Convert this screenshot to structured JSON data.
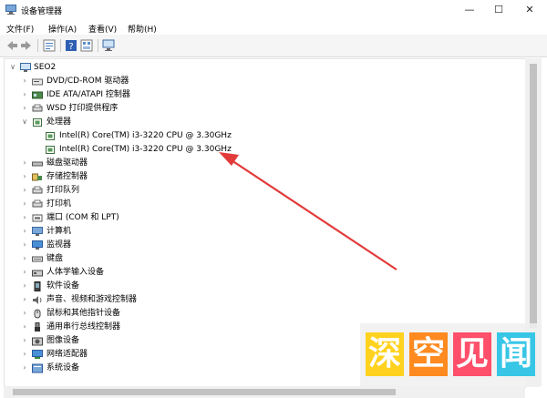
{
  "window": {
    "title": "设备管理器",
    "minimize": "—",
    "maximize": "☐",
    "close": "✕"
  },
  "menu": [
    "文件(F)",
    "操作(A)",
    "查看(V)",
    "帮助(H)"
  ],
  "tree": {
    "root": "SEO2",
    "items": [
      {
        "label": "DVD/CD-ROM 驱动器",
        "icon": "dvd-drive-icon",
        "expanded": false
      },
      {
        "label": "IDE ATA/ATAPI 控制器",
        "icon": "ide-controller-icon",
        "expanded": false
      },
      {
        "label": "WSD 打印提供程序",
        "icon": "printer-provider-icon",
        "expanded": false
      },
      {
        "label": "处理器",
        "icon": "processor-icon",
        "expanded": true,
        "children": [
          "Intel(R) Core(TM) i3-3220 CPU @ 3.30GHz",
          "Intel(R) Core(TM) i3-3220 CPU @ 3.30GHz"
        ]
      },
      {
        "label": "磁盘驱动器",
        "icon": "disk-drive-icon",
        "expanded": false
      },
      {
        "label": "存储控制器",
        "icon": "storage-controller-icon",
        "expanded": false
      },
      {
        "label": "打印队列",
        "icon": "print-queue-icon",
        "expanded": false
      },
      {
        "label": "打印机",
        "icon": "printer-icon",
        "expanded": false
      },
      {
        "label": "端口 (COM 和 LPT)",
        "icon": "port-icon",
        "expanded": false
      },
      {
        "label": "计算机",
        "icon": "computer-icon",
        "expanded": false
      },
      {
        "label": "监视器",
        "icon": "monitor-icon",
        "expanded": false
      },
      {
        "label": "键盘",
        "icon": "keyboard-icon",
        "expanded": false
      },
      {
        "label": "人体学输入设备",
        "icon": "hid-icon",
        "expanded": false
      },
      {
        "label": "软件设备",
        "icon": "software-device-icon",
        "expanded": false
      },
      {
        "label": "声音、视频和游戏控制器",
        "icon": "sound-icon",
        "expanded": false
      },
      {
        "label": "鼠标和其他指针设备",
        "icon": "mouse-icon",
        "expanded": false
      },
      {
        "label": "通用串行总线控制器",
        "icon": "usb-icon",
        "expanded": false
      },
      {
        "label": "图像设备",
        "icon": "imaging-device-icon",
        "expanded": false
      },
      {
        "label": "网络适配器",
        "icon": "network-adapter-icon",
        "expanded": false
      },
      {
        "label": "系统设备",
        "icon": "system-device-icon",
        "expanded": false
      }
    ]
  },
  "watermark": [
    "深",
    "空",
    "见",
    "闻"
  ],
  "colors": {
    "accent": "#e5f1fb",
    "arrow": "#e23b3b",
    "watermark": [
      "#ffd21f",
      "#ff8a1f",
      "#ff4f6a",
      "#37c6e6"
    ]
  }
}
